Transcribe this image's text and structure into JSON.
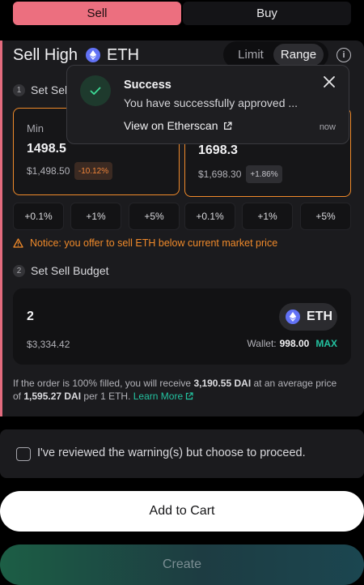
{
  "side_toggle": {
    "sell": "Sell",
    "buy": "Buy"
  },
  "header": {
    "title": "Sell High",
    "asset": "ETH"
  },
  "mode_toggle": {
    "limit": "Limit",
    "range": "Range",
    "selected": "Range"
  },
  "step1": {
    "number": "1",
    "label": "Set Sell"
  },
  "min_card": {
    "label": "Min",
    "price": "1498.5",
    "usd": "$1,498.50",
    "change": "-10.12%"
  },
  "max_card": {
    "price": "1698.3",
    "usd": "$1,698.30",
    "change": "+1.86%"
  },
  "pct_buttons": [
    "+0.1%",
    "+1%",
    "+5%",
    "+0.1%",
    "+1%",
    "+5%"
  ],
  "notice": "Notice: you offer to sell ETH below current market price",
  "step2": {
    "number": "2",
    "label": "Set Sell Budget"
  },
  "budget": {
    "amount": "2",
    "usd": "$3,334.42",
    "asset": "ETH",
    "wallet_label": "Wallet:",
    "wallet_value": "998.00",
    "max": "MAX"
  },
  "summary": {
    "part1": "If the order is 100% filled, you will receive ",
    "receive": "3,190.55 DAI",
    "part2": " at an average price of ",
    "avg_price": "1,595.27 DAI",
    "part3": " per 1 ETH. ",
    "learn_more": "Learn More"
  },
  "ack": "I've reviewed the warning(s) but choose to proceed.",
  "actions": {
    "add_to_cart": "Add to Cart",
    "create": "Create"
  },
  "toast": {
    "title": "Success",
    "message": "You have successfully approved ...",
    "link": "View on Etherscan",
    "time": "now"
  },
  "colors": {
    "sell_accent": "#ec6f7f",
    "warning": "#f08a2a",
    "teal": "#23c2a0",
    "eth": "#6272f5"
  }
}
